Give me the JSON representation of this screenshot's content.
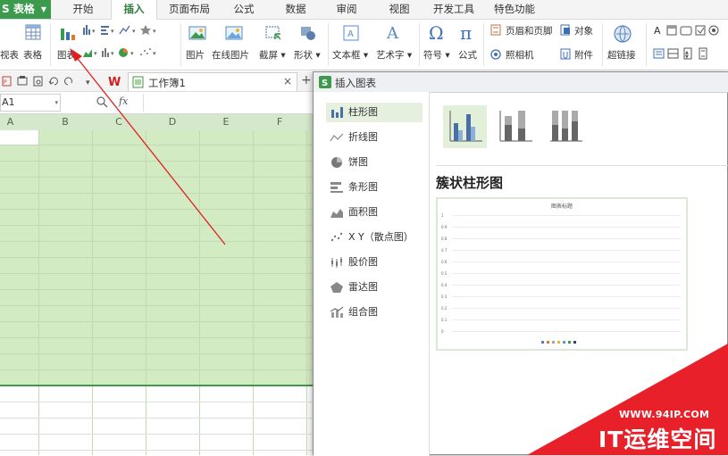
{
  "app": {
    "title": "S 表格"
  },
  "tabs": [
    "开始",
    "插入",
    "页面布局",
    "公式",
    "数据",
    "审阅",
    "视图",
    "开发工具",
    "特色功能"
  ],
  "active_tab": "插入",
  "ribbon": {
    "pivot_partial": "视表",
    "table": "表格",
    "chart": "图表",
    "picture": "图片",
    "online_picture": "在线图片",
    "screenshot": "截屏",
    "shapes": "形状",
    "textbox": "文本框",
    "wordart": "艺术字",
    "symbol": "符号",
    "formula": "公式",
    "header_footer": "页眉和页脚",
    "object": "对象",
    "camera": "照相机",
    "attachment": "附件",
    "hyperlink": "超链接"
  },
  "doc_tab": {
    "title": "工作簿1",
    "close": "×",
    "new": "+"
  },
  "formula_bar": {
    "name_box": "A1",
    "fx": "fx"
  },
  "columns": [
    "A",
    "B",
    "C",
    "D",
    "E",
    "F"
  ],
  "dialog": {
    "title": "插入图表",
    "chart_types": [
      "柱形图",
      "折线图",
      "饼图",
      "条形图",
      "面积图",
      "X Y（散点图）",
      "股价图",
      "雷达图",
      "组合图"
    ],
    "selected_type": "柱形图",
    "subtype_title": "簇状柱形图",
    "preview": {
      "chart_title": "图表标题",
      "y_ticks": [
        "1",
        "0.9",
        "0.8",
        "0.7",
        "0.6",
        "0.5",
        "0.4",
        "0.3",
        "0.2",
        "0.1",
        "0"
      ]
    }
  },
  "watermark": {
    "url": "WWW.94IP.COM",
    "brand": "IT运维空间"
  },
  "colors": {
    "brand_green": "#3c9a4c",
    "selection_fill": "#d3ebc3",
    "annotation_arrow": "#e02020",
    "watermark_red": "#e8202a"
  }
}
